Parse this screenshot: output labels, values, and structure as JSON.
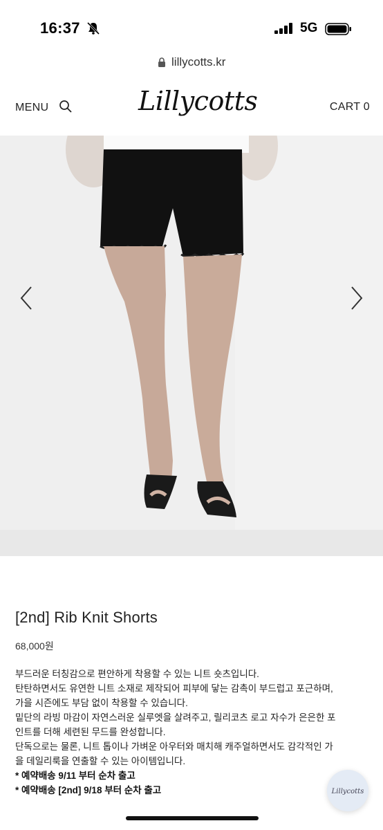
{
  "status_bar": {
    "time": "16:37",
    "network": "5G"
  },
  "url_bar": {
    "url": "lillycotts.kr"
  },
  "header": {
    "menu_label": "MENU",
    "logo_text": "Lillycotts",
    "cart_label": "CART 0"
  },
  "product": {
    "title": "[2nd] Rib Knit Shorts",
    "price": "68,000원",
    "description": [
      "부드러운 터칭감으로 편안하게 착용할 수 있는 니트 숏츠입니다.",
      "탄탄하면서도 유연한 니트 소재로 제작되어 피부에 닿는 감촉이 부드럽고 포근하며,",
      "가을 시즌에도 부담 없이 착용할 수 있습니다.",
      "밑단의 라빙 마감이 자연스러운 실루엣을 살려주고, 릴리코츠 로고 자수가 은은한 포",
      "인트를 더해 세련된 무드를 완성합니다.",
      "단독으로는 물론, 니트 톱이나 가벼운 아우터와 매치해 캐주얼하면서도 감각적인 가",
      "을 데일리룩을 연출할 수 있는 아이템입니다."
    ],
    "notices": [
      "* 예약배송 9/11 부터 순차 출고",
      "* 예약배송 [2nd] 9/18 부터 순차 출고"
    ]
  },
  "badge": {
    "text": "Lillycotts"
  },
  "icons": [
    "mute-bell-icon",
    "signal-icon",
    "battery-icon",
    "lock-icon",
    "search-icon",
    "chevron-left-icon",
    "chevron-right-icon"
  ]
}
